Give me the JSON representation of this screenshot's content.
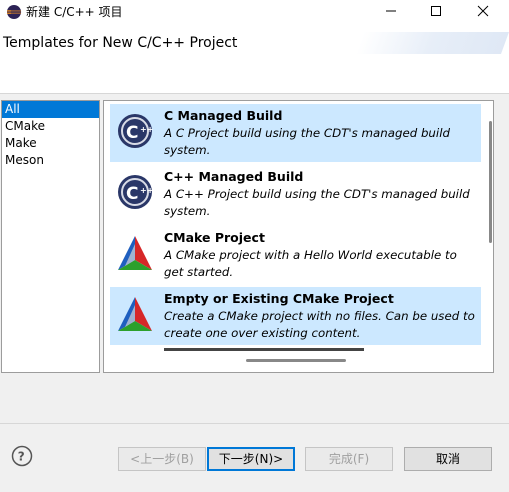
{
  "window": {
    "title": "新建 C/C++ 项目"
  },
  "header": {
    "title": "Templates for New C/C++ Project"
  },
  "left_list": {
    "items": [
      {
        "label": "All",
        "selected": true
      },
      {
        "label": "CMake",
        "selected": false
      },
      {
        "label": "Make",
        "selected": false
      },
      {
        "label": "Meson",
        "selected": false
      }
    ]
  },
  "templates": [
    {
      "name": "C Managed Build",
      "description": "A C Project build using the CDT's managed build system.",
      "icon": "cdt-c-icon",
      "selected": true
    },
    {
      "name": "C++ Managed Build",
      "description": "A C++ Project build using the CDT's managed build system.",
      "icon": "cdt-c-icon",
      "selected": false
    },
    {
      "name": "CMake Project",
      "description": "A CMake project with a Hello World executable to get started.",
      "icon": "cmake-triangle-icon",
      "selected": false
    },
    {
      "name": "Empty or Existing CMake Project",
      "description": "Create a CMake project with no files. Can be used to create one over existing content.",
      "icon": "cmake-triangle-icon",
      "selected": true
    }
  ],
  "buttons": {
    "back": "<上一步(B)",
    "next": "下一步(N)>",
    "finish": "完成(F)",
    "cancel": "取消"
  },
  "colors": {
    "selection": "#0078d7",
    "template_highlight": "#cce8ff"
  }
}
